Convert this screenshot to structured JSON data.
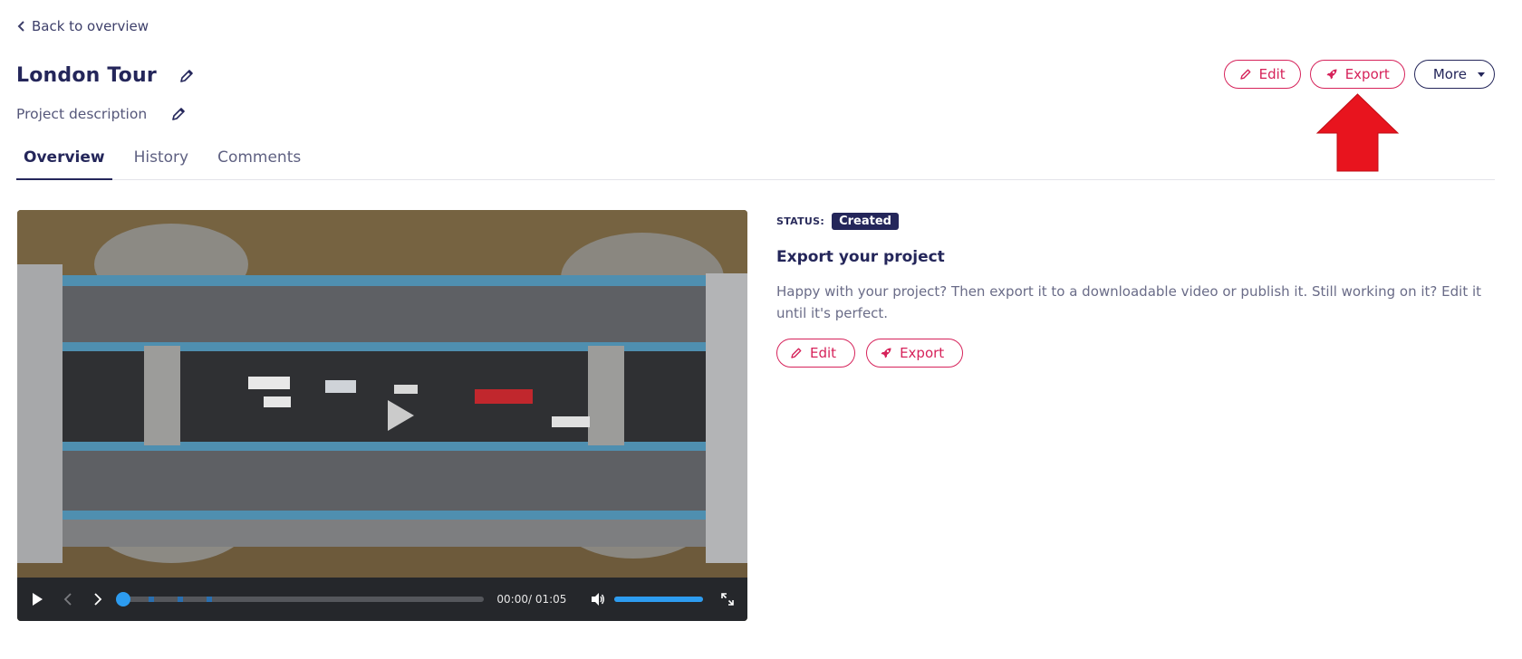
{
  "nav": {
    "back_label": "Back to overview"
  },
  "project": {
    "title": "London Tour",
    "description": "Project description"
  },
  "tabs": [
    {
      "label": "Overview",
      "active": true
    },
    {
      "label": "History",
      "active": false
    },
    {
      "label": "Comments",
      "active": false
    }
  ],
  "header_actions": {
    "edit_label": "Edit",
    "export_label": "Export",
    "more_label": "More"
  },
  "video": {
    "time_display": "00:00/ 01:05",
    "current_time": "00:00",
    "duration": "01:05",
    "progress": 0,
    "volume": 1.0
  },
  "panel": {
    "status_label": "STATUS:",
    "status_value": "Created",
    "title": "Export your project",
    "text": "Happy with your project? Then export it to a downloadable video or publish it. Still working on it? Edit it until it's perfect.",
    "edit_label": "Edit",
    "export_label": "Export"
  },
  "colors": {
    "accent": "#d6225a",
    "navy": "#24265a",
    "player_blue": "#2d9cf0",
    "annotation_arrow": "#e8141e"
  },
  "icons": {
    "back": "chevron-left-icon",
    "pencil": "pencil-icon",
    "export": "rocket-icon",
    "more": "caret-down-icon",
    "play": "play-icon",
    "prev": "chevron-left-icon",
    "next": "chevron-right-icon",
    "volume": "volume-icon",
    "fullscreen": "fullscreen-icon"
  }
}
